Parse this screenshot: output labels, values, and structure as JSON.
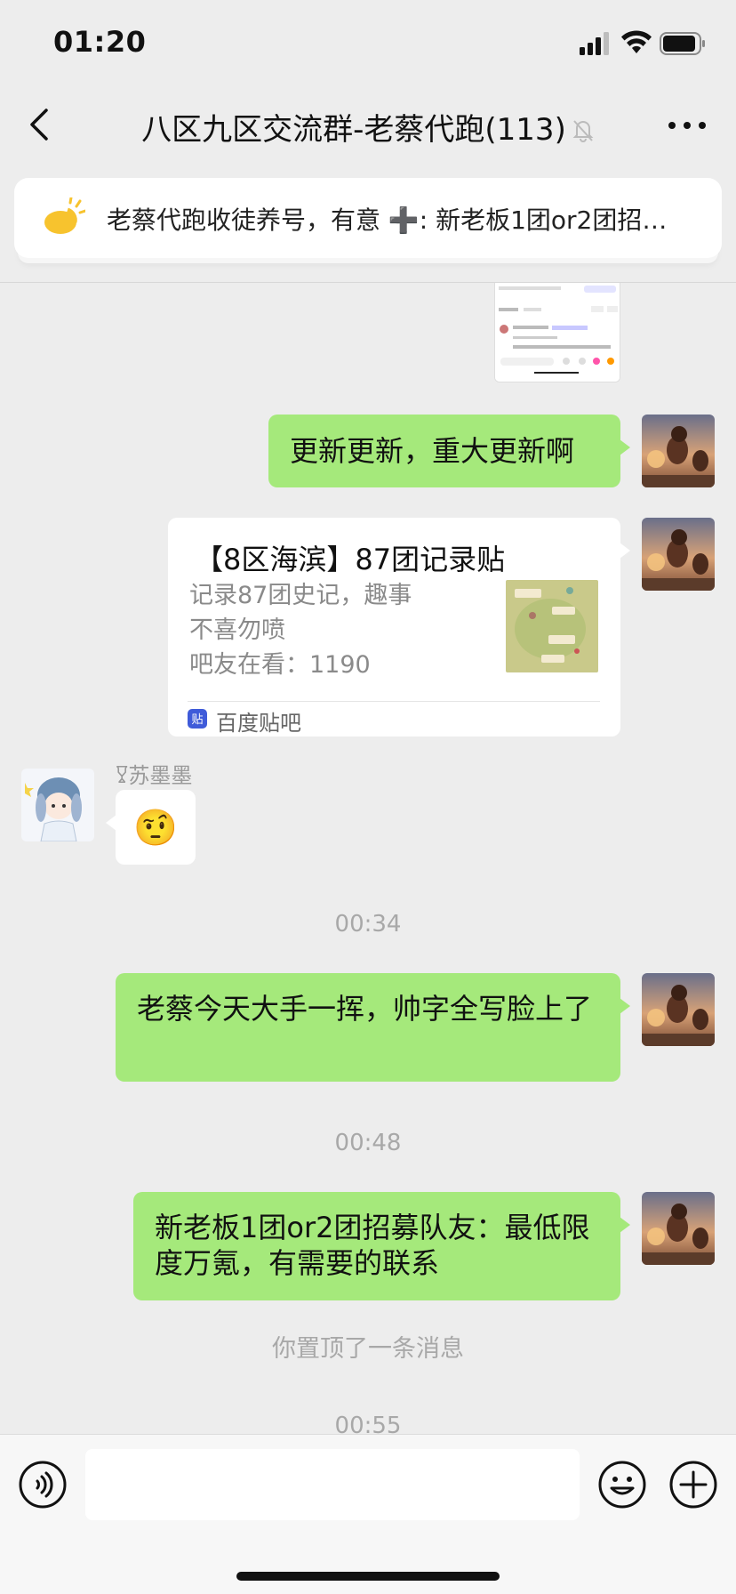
{
  "status_bar": {
    "time": "01:20"
  },
  "nav": {
    "title": "八区九区交流群-老蔡代跑(113)",
    "icons": {
      "back": "chevron-left-icon",
      "mute": "bell-off-icon",
      "more": "more-horizontal-icon"
    }
  },
  "pinned": {
    "icon": "announcement-icon",
    "text": "老蔡代跑收徒养号，有意 ➕: 新老板1团or2团招…"
  },
  "messages": {
    "msg1": "更新更新，重大更新啊",
    "link_card": {
      "title": "【8区海滨】87团记录贴",
      "desc_line1": "记录87团史记，趣事",
      "desc_line2": "不喜勿喷",
      "desc_line3": "吧友在看：1190",
      "source": "百度贴吧"
    },
    "incoming": {
      "sender": "苏墨墨",
      "emoji": "🤨"
    },
    "ts1": "00:34",
    "msg2": "老蔡今天大手一挥，帅字全写脸上了",
    "ts2": "00:48",
    "msg3": "新老板1团or2团招募队友：最低限度万氪，有需要的联系",
    "pin_note": "你置顶了一条消息",
    "ts3": "00:55"
  },
  "input_bar": {
    "placeholder": "",
    "icons": {
      "voice": "voice-icon",
      "emoji": "smiley-icon",
      "plus": "plus-circle-icon"
    }
  },
  "colors": {
    "background": "#ededed",
    "bubble_outgoing": "#a5e97b",
    "bubble_incoming": "#ffffff",
    "timestamp": "#a8a8a8"
  }
}
